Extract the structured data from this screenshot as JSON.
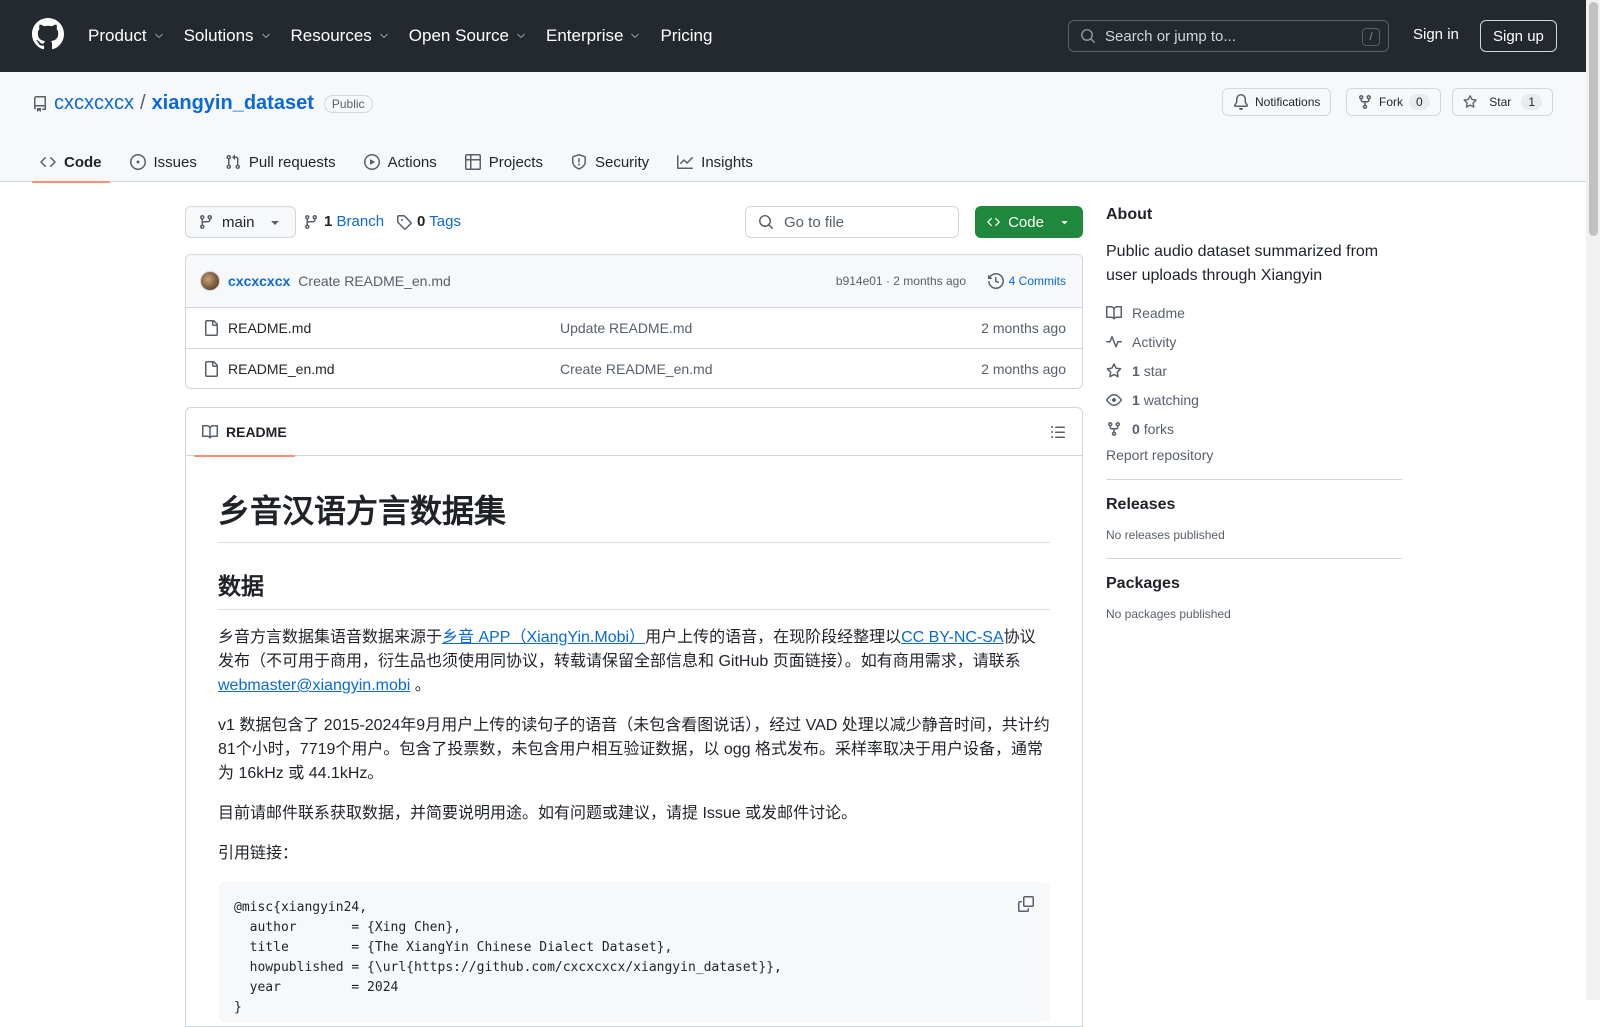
{
  "topnav": {
    "items": [
      "Product",
      "Solutions",
      "Resources",
      "Open Source",
      "Enterprise"
    ],
    "pricing": "Pricing",
    "search_placeholder": "Search or jump to...",
    "search_shortcut": "/",
    "signin": "Sign in",
    "signup": "Sign up"
  },
  "repo": {
    "owner": "cxcxcxcx",
    "separator": "/",
    "name": "xiangyin_dataset",
    "visibility": "Public",
    "notifications": "Notifications",
    "fork_label": "Fork",
    "fork_count": "0",
    "star_label": "Star",
    "star_count": "1"
  },
  "tabs": [
    "Code",
    "Issues",
    "Pull requests",
    "Actions",
    "Projects",
    "Security",
    "Insights"
  ],
  "toolbar": {
    "branch": "main",
    "branch_count": "1",
    "branch_label": "Branch",
    "tag_count": "0",
    "tag_label": "Tags",
    "gofile_placeholder": "Go to file",
    "code_label": "Code"
  },
  "commit": {
    "author": "cxcxcxcx",
    "message": "Create README_en.md",
    "meta": "b914e01 · 2 months ago",
    "commits": "4 Commits"
  },
  "files": [
    {
      "name": "README.md",
      "message": "Update README.md",
      "date": "2 months ago"
    },
    {
      "name": "README_en.md",
      "message": "Create README_en.md",
      "date": "2 months ago"
    }
  ],
  "readme": {
    "tab": "README",
    "h1": "乡音汉语方言数据集",
    "h2": "数据",
    "p1_a": "乡音方言数据集语音数据来源于",
    "p1_link1": "乡音 APP（XiangYin.Mobi）",
    "p1_b": "用户上传的语音，在现阶段经整理以",
    "p1_link2": "CC BY-NC-SA",
    "p1_c": "协议发布（不可用于商用，衍生品也须使用同协议，转载请保留全部信息和 GitHub 页面链接）。如有商用需求，请联系",
    "p1_email": "webmaster@xiangyin.mobi",
    "p1_d": " 。",
    "p2": "v1 数据包含了 2015-2024年9月用户上传的读句子的语音（未包含看图说话），经过 VAD 处理以减少静音时间，共计约81个小时，7719个用户。包含了投票数，未包含用户相互验证数据，以 ogg 格式发布。采样率取决于用户设备，通常为 16kHz 或 44.1kHz。",
    "p3": "目前请邮件联系获取数据，并简要说明用途。如有问题或建议，请提 Issue 或发邮件讨论。",
    "p4": "引用链接：",
    "code": "@misc{xiangyin24,\n  author       = {Xing Chen},\n  title        = {The XiangYin Chinese Dialect Dataset},\n  howpublished = {\\url{https://github.com/cxcxcxcx/xiangyin_dataset}},\n  year         = 2024\n}"
  },
  "about": {
    "title": "About",
    "description": "Public audio dataset summarized from user uploads through Xiangyin",
    "readme": "Readme",
    "activity": "Activity",
    "stars_count": "1",
    "stars_label": "star",
    "watching_count": "1",
    "watching_label": "watching",
    "forks_count": "0",
    "forks_label": "forks",
    "report": "Report repository"
  },
  "releases": {
    "title": "Releases",
    "empty": "No releases published"
  },
  "packages": {
    "title": "Packages",
    "empty": "No packages published"
  },
  "colors": {
    "header_bg": "#24292f",
    "accent": "#0969da",
    "tab_underline": "#fd8c73",
    "code_button": "#1f883d"
  }
}
